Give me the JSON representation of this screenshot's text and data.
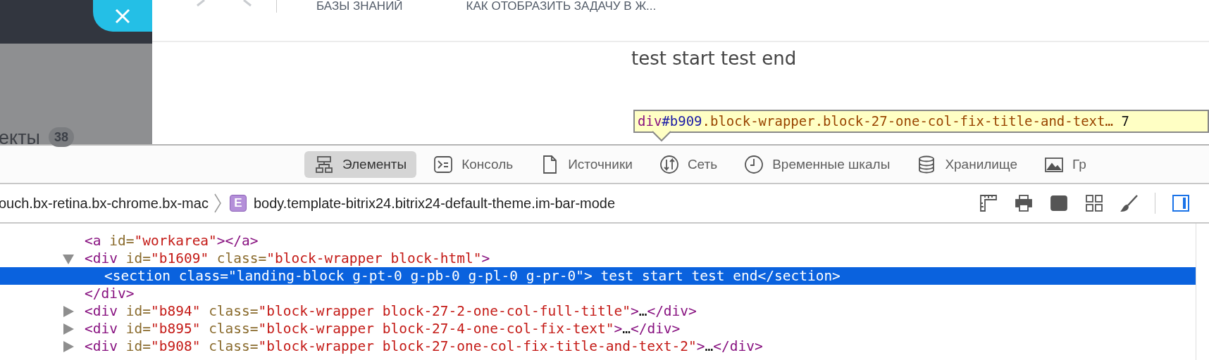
{
  "sidebar": {
    "label": "екты",
    "badge": "38"
  },
  "top_nav": {
    "items": [
      "БАЗЫ ЗНАНИЙ",
      "КАК ОТОБРАЗИТЬ ЗАДАЧУ В Ж..."
    ]
  },
  "page": {
    "text": "test start test end"
  },
  "tooltip": {
    "tag": "div",
    "id": "#b909",
    "classes": ".block-wrapper.block-27-one-col-fix-title-and-text…",
    "size": "7"
  },
  "devtools": {
    "tabs": [
      {
        "label": "Элементы",
        "kind": "elements",
        "selected": true
      },
      {
        "label": "Консоль",
        "kind": "console",
        "selected": false
      },
      {
        "label": "Источники",
        "kind": "sources",
        "selected": false
      },
      {
        "label": "Сеть",
        "kind": "network",
        "selected": false
      },
      {
        "label": "Временные шкалы",
        "kind": "timelines",
        "selected": false
      },
      {
        "label": "Хранилище",
        "kind": "storage",
        "selected": false
      },
      {
        "label": "Гр",
        "kind": "graphics",
        "selected": false
      }
    ],
    "breadcrumbs": [
      {
        "label": "ouch.bx-retina.bx-chrome.bx-mac"
      },
      {
        "badge": "E",
        "label": "body.template-bitrix24.bitrix24-default-theme.im-bar-mode"
      }
    ],
    "dom": [
      {
        "selected": false,
        "tokens": [
          {
            "kind": "tag",
            "text": "<a"
          },
          {
            "kind": "attr",
            "text": " id="
          },
          {
            "kind": "value",
            "text": "\"workarea\""
          },
          {
            "kind": "tag",
            "text": "></a>"
          }
        ]
      },
      {
        "selected": false,
        "expanded": true,
        "tokens": [
          {
            "kind": "tag",
            "text": "<div"
          },
          {
            "kind": "attr",
            "text": " id="
          },
          {
            "kind": "value",
            "text": "\"b1609\""
          },
          {
            "kind": "attr",
            "text": " class="
          },
          {
            "kind": "value",
            "text": "\"block-wrapper block-html\""
          },
          {
            "kind": "tag",
            "text": ">"
          }
        ],
        "children": [
          {
            "selected": true,
            "text": "<section class=\"landing-block g-pt-0 g-pb-0 g-pl-0 g-pr-0\"> test start test end</section>"
          }
        ],
        "closing": [
          {
            "kind": "tag",
            "text": "</div>"
          }
        ]
      },
      {
        "selected": false,
        "expanded": false,
        "tokens": [
          {
            "kind": "tag",
            "text": "<div"
          },
          {
            "kind": "attr",
            "text": " id="
          },
          {
            "kind": "value",
            "text": "\"b894\""
          },
          {
            "kind": "attr",
            "text": " class="
          },
          {
            "kind": "value",
            "text": "\"block-wrapper block-27-2-one-col-full-title\""
          },
          {
            "kind": "tag",
            "text": ">"
          },
          {
            "kind": "text",
            "text": "…"
          },
          {
            "kind": "tag",
            "text": "</div>"
          }
        ]
      },
      {
        "selected": false,
        "expanded": false,
        "tokens": [
          {
            "kind": "tag",
            "text": "<div"
          },
          {
            "kind": "attr",
            "text": " id="
          },
          {
            "kind": "value",
            "text": "\"b895\""
          },
          {
            "kind": "attr",
            "text": " class="
          },
          {
            "kind": "value",
            "text": "\"block-wrapper block-27-4-one-col-fix-text\""
          },
          {
            "kind": "tag",
            "text": ">"
          },
          {
            "kind": "text",
            "text": "…"
          },
          {
            "kind": "tag",
            "text": "</div>"
          }
        ]
      },
      {
        "selected": false,
        "expanded": false,
        "tokens": [
          {
            "kind": "tag",
            "text": "<div"
          },
          {
            "kind": "attr",
            "text": " id="
          },
          {
            "kind": "value",
            "text": "\"b908\""
          },
          {
            "kind": "attr",
            "text": " class="
          },
          {
            "kind": "value",
            "text": "\"block-wrapper block-27-one-col-fix-title-and-text-2\""
          },
          {
            "kind": "tag",
            "text": ">"
          },
          {
            "kind": "text",
            "text": "…"
          },
          {
            "kind": "tag",
            "text": "</div>"
          }
        ]
      }
    ]
  }
}
